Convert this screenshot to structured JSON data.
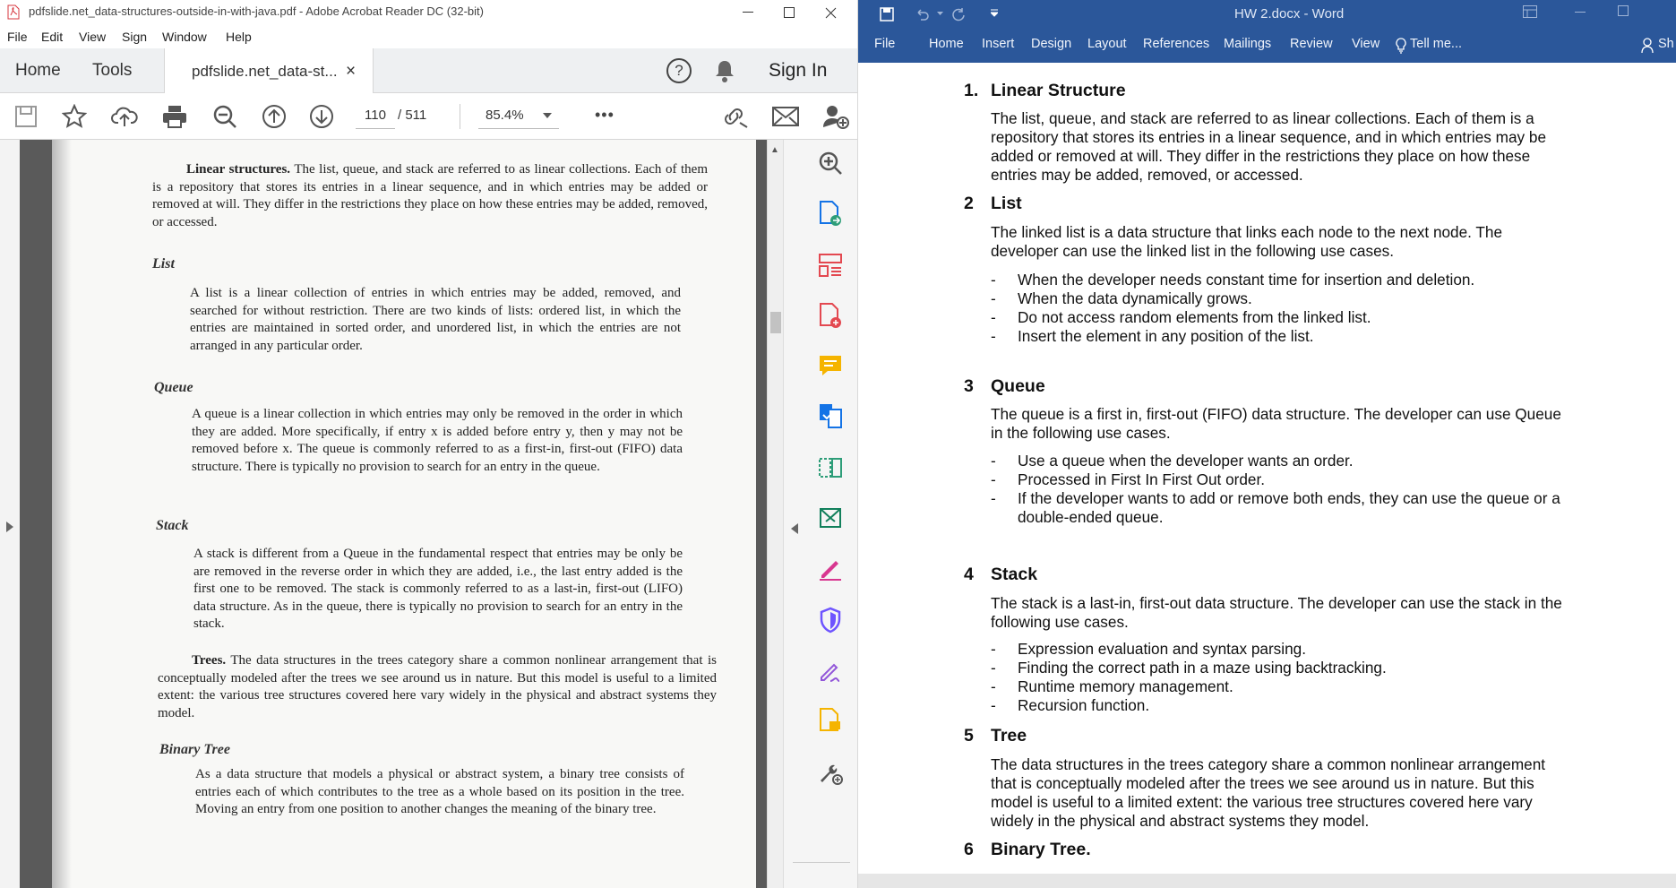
{
  "acrobat": {
    "title": "pdfslide.net_data-structures-outside-in-with-java.pdf - Adobe Acrobat Reader DC (32-bit)",
    "menu": [
      "File",
      "Edit",
      "View",
      "Sign",
      "Window",
      "Help"
    ],
    "tabs": {
      "home": "Home",
      "tools": "Tools",
      "document": "pdfslide.net_data-st...",
      "close": "×"
    },
    "sign_in": "Sign In",
    "page_current": "110",
    "page_separator": "/ 511",
    "zoom": "85.4%",
    "more": "•••",
    "page": {
      "linear_lead": "Linear structures.",
      "linear_body": "The list, queue, and stack are referred to as linear collections. Each of them is a repository that stores its entries in a linear sequence, and in which entries may be added or removed at will. They differ in the restrictions they place on how these entries may be added, removed, or accessed.",
      "list_heading": "List",
      "list_body": "A list is a linear collection of entries in which entries may be added, removed, and searched for without restriction. There are two kinds of lists: ordered list, in which the entries are maintained in sorted order, and unordered list, in which the entries are not arranged in any particular order.",
      "queue_heading": "Queue",
      "queue_body": "A queue is a linear collection in which entries may only be removed in the order in which they are added. More specifically, if entry x is added before entry y, then y may not be removed before x. The queue is commonly referred to as a first-in, first-out (FIFO) data structure. There is typically no provision to search for an entry in the queue.",
      "stack_heading": "Stack",
      "stack_body": "A stack is different from a Queue in the fundamental respect that entries may be only be are removed in the reverse order in which they are added, i.e., the last entry added is the first one to be removed. The stack is commonly referred to as a last-in, first-out (LIFO) data structure. As in the queue, there is typically no provision to search for an entry in the stack.",
      "trees_lead": "Trees.",
      "trees_body": "The data structures in the trees category share a common nonlinear arrangement that is conceptually modeled after the trees we see around us in nature. But this model is useful to a limited extent: the various tree structures covered here vary widely in the physical and abstract systems they model.",
      "binary_heading": "Binary Tree",
      "binary_body": "As a data structure that models a physical or abstract system, a binary tree consists of entries each of which contributes to the tree as a whole based on its position in the tree. Moving an entry from one position to another changes the meaning of the binary tree."
    }
  },
  "word": {
    "title": "HW 2.docx - Word",
    "tabs": [
      "File",
      "Home",
      "Insert",
      "Design",
      "Layout",
      "References",
      "Mailings",
      "Review",
      "View",
      "Tell me...",
      "Sh"
    ],
    "sections": [
      {
        "num": "1.",
        "title": "Linear Structure"
      },
      {
        "num": "2",
        "title": "List"
      },
      {
        "num": "3",
        "title": "Queue"
      },
      {
        "num": "4",
        "title": "Stack"
      },
      {
        "num": "5",
        "title": "Tree"
      },
      {
        "num": "6",
        "title": "Binary Tree."
      }
    ],
    "linear_p": "The list, queue, and stack are referred to as linear collections. Each of them is a repository that stores its entries in a linear sequence, and in which entries may be added or removed at will. They differ in the restrictions they place on how these entries may be added, removed, or  accessed.",
    "list_p": "The linked list is a data structure that links each node to the next node. The developer can use the linked list in the following use cases.",
    "list_items": [
      "When the developer needs constant time for insertion and deletion.",
      "When the data dynamically grows.",
      "Do not access random elements from the linked list.",
      "Insert the element in any position of the list."
    ],
    "queue_p": "The queue is a first in, first-out (FIFO) data structure. The developer can use Queue in the following use cases.",
    "queue_items": [
      "Use a queue when the developer wants an order.",
      "Processed in First In First Out order.",
      "If the developer wants to add or remove both ends, they can use the queue or a double-ended queue."
    ],
    "stack_p": "The stack is a last-in, first-out data structure. The developer can use the stack in the following use cases.",
    "stack_items": [
      "Expression evaluation and syntax parsing.",
      "Finding the correct path in a maze using backtracking.",
      "Runtime memory management.",
      "Recursion function."
    ],
    "tree_p": "The data structures in the trees category share a common nonlinear arrangement that is conceptually modeled after the trees we see around us in nature. But this model is useful to a limited extent: the various tree structures covered here vary widely in the physical and abstract systems they model.",
    "dash": "-"
  },
  "colors": {
    "word_blue": "#2b579a",
    "acrobat_red": "#d7373f"
  }
}
